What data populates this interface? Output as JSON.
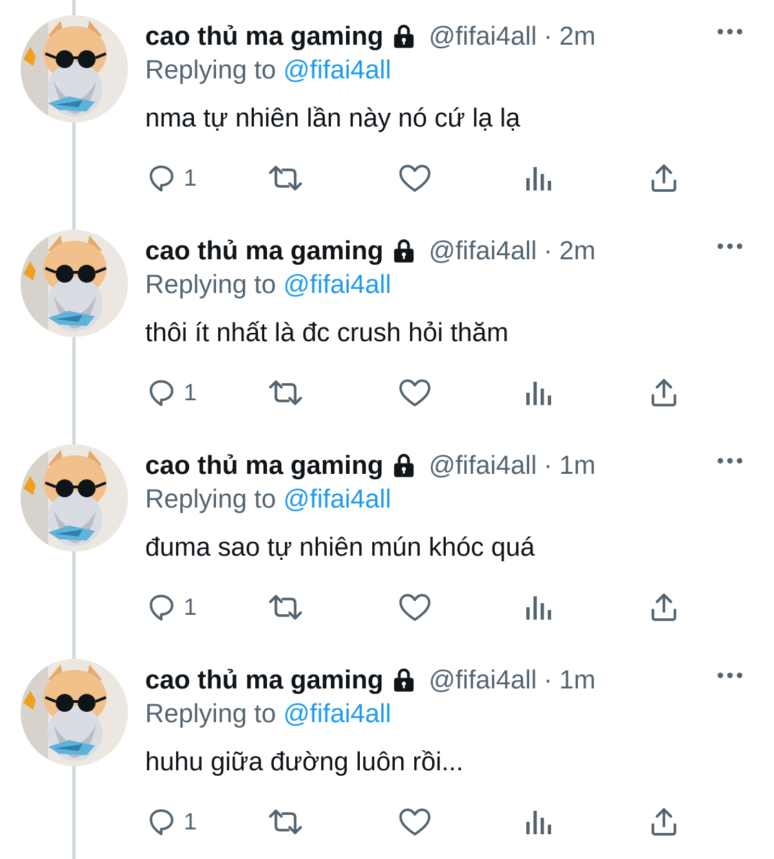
{
  "tweets": [
    {
      "display_name": "cao thủ ma gaming",
      "handle": "@fifai4all",
      "separator": "·",
      "time": "2m",
      "reply_prefix": "Replying to",
      "reply_to": "@fifai4all",
      "text": "nma tự nhiên lần này nó cứ lạ lạ",
      "reply_count": "1"
    },
    {
      "display_name": "cao thủ ma gaming",
      "handle": "@fifai4all",
      "separator": "·",
      "time": "2m",
      "reply_prefix": "Replying to",
      "reply_to": "@fifai4all",
      "text": "thôi ít nhất là đc crush hỏi thăm",
      "reply_count": "1"
    },
    {
      "display_name": "cao thủ ma gaming",
      "handle": "@fifai4all",
      "separator": "·",
      "time": "1m",
      "reply_prefix": "Replying to",
      "reply_to": "@fifai4all",
      "text": "đuma sao tự nhiên mún khóc quá",
      "reply_count": "1"
    },
    {
      "display_name": "cao thủ ma gaming",
      "handle": "@fifai4all",
      "separator": "·",
      "time": "1m",
      "reply_prefix": "Replying to",
      "reply_to": "@fifai4all",
      "text": "huhu giữa đường luôn rồi...",
      "reply_count": "1"
    }
  ],
  "icons": {
    "lock": "lock-icon",
    "more": "more-options-icon",
    "reply": "reply-icon",
    "retweet": "retweet-icon",
    "like": "heart-icon",
    "views": "views-bar-chart-icon",
    "share": "share-icon"
  },
  "colors": {
    "text": "#0f1419",
    "secondary": "#536471",
    "link": "#1d9bf0",
    "thread_line": "#cfd9de",
    "icon": "#536471"
  }
}
